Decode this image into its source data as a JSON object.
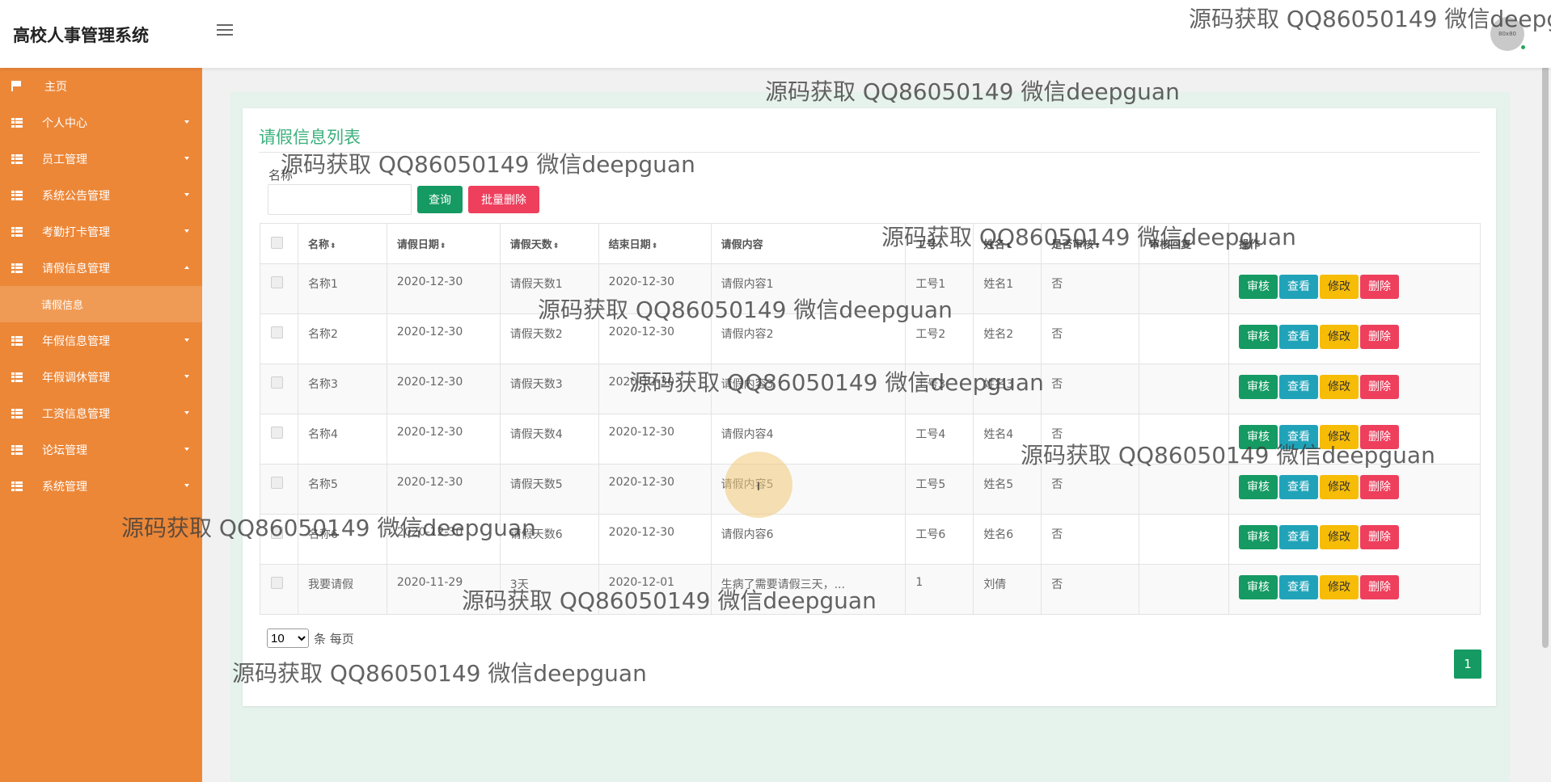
{
  "app": {
    "title": "高校人事管理系统",
    "avatar_text": "80x80"
  },
  "sidebar": {
    "items": [
      {
        "label": "主页",
        "icon": "flag-icon",
        "expanded": null
      },
      {
        "label": "个人中心",
        "icon": "grid-icon",
        "expanded": false
      },
      {
        "label": "员工管理",
        "icon": "grid-icon",
        "expanded": false
      },
      {
        "label": "系统公告管理",
        "icon": "grid-icon",
        "expanded": false
      },
      {
        "label": "考勤打卡管理",
        "icon": "grid-icon",
        "expanded": false
      },
      {
        "label": "请假信息管理",
        "icon": "grid-icon",
        "expanded": true,
        "sub": [
          "请假信息"
        ]
      },
      {
        "label": "年假信息管理",
        "icon": "grid-icon",
        "expanded": false
      },
      {
        "label": "年假调休管理",
        "icon": "grid-icon",
        "expanded": false
      },
      {
        "label": "工资信息管理",
        "icon": "grid-icon",
        "expanded": false
      },
      {
        "label": "论坛管理",
        "icon": "grid-icon",
        "expanded": false
      },
      {
        "label": "系统管理",
        "icon": "grid-icon",
        "expanded": false
      }
    ]
  },
  "panel": {
    "title": "请假信息列表",
    "search_label": "名称",
    "search_value": "",
    "query_button": "查询",
    "batch_delete_button": "批量删除"
  },
  "table": {
    "sort_glyph": "⬍",
    "columns": [
      "名称",
      "请假日期",
      "请假天数",
      "结束日期",
      "请假内容",
      "工号",
      "姓名",
      "是否审核",
      "审核回复",
      "操作"
    ],
    "sortable": [
      true,
      true,
      true,
      true,
      false,
      true,
      true,
      true,
      false,
      false
    ],
    "rows": [
      [
        "名称1",
        "2020-12-30",
        "请假天数1",
        "2020-12-30",
        "请假内容1",
        "工号1",
        "姓名1",
        "否",
        ""
      ],
      [
        "名称2",
        "2020-12-30",
        "请假天数2",
        "2020-12-30",
        "请假内容2",
        "工号2",
        "姓名2",
        "否",
        ""
      ],
      [
        "名称3",
        "2020-12-30",
        "请假天数3",
        "2020-12-30",
        "请假内容3",
        "工号3",
        "姓名3",
        "否",
        ""
      ],
      [
        "名称4",
        "2020-12-30",
        "请假天数4",
        "2020-12-30",
        "请假内容4",
        "工号4",
        "姓名4",
        "否",
        ""
      ],
      [
        "名称5",
        "2020-12-30",
        "请假天数5",
        "2020-12-30",
        "请假内容5",
        "工号5",
        "姓名5",
        "否",
        ""
      ],
      [
        "名称6",
        "2020-12-30",
        "请假天数6",
        "2020-12-30",
        "请假内容6",
        "工号6",
        "姓名6",
        "否",
        ""
      ],
      [
        "我要请假",
        "2020-11-29",
        "3天",
        "2020-12-01",
        "生病了需要请假三天，...",
        "1",
        "刘倩",
        "否",
        ""
      ]
    ],
    "actions": [
      "审核",
      "查看",
      "修改",
      "删除"
    ]
  },
  "pagination": {
    "page_size": "10",
    "page_size_suffix": "条 每页",
    "current_page": "1"
  },
  "watermark": "源码获取 QQ86050149 微信deepguan",
  "colors": {
    "sidebar": "#ec8738",
    "accent_green": "#149a62",
    "danger": "#ee3f5d",
    "info": "#20a3b8",
    "warning": "#f7bc06",
    "title_green": "#3bb07c"
  }
}
